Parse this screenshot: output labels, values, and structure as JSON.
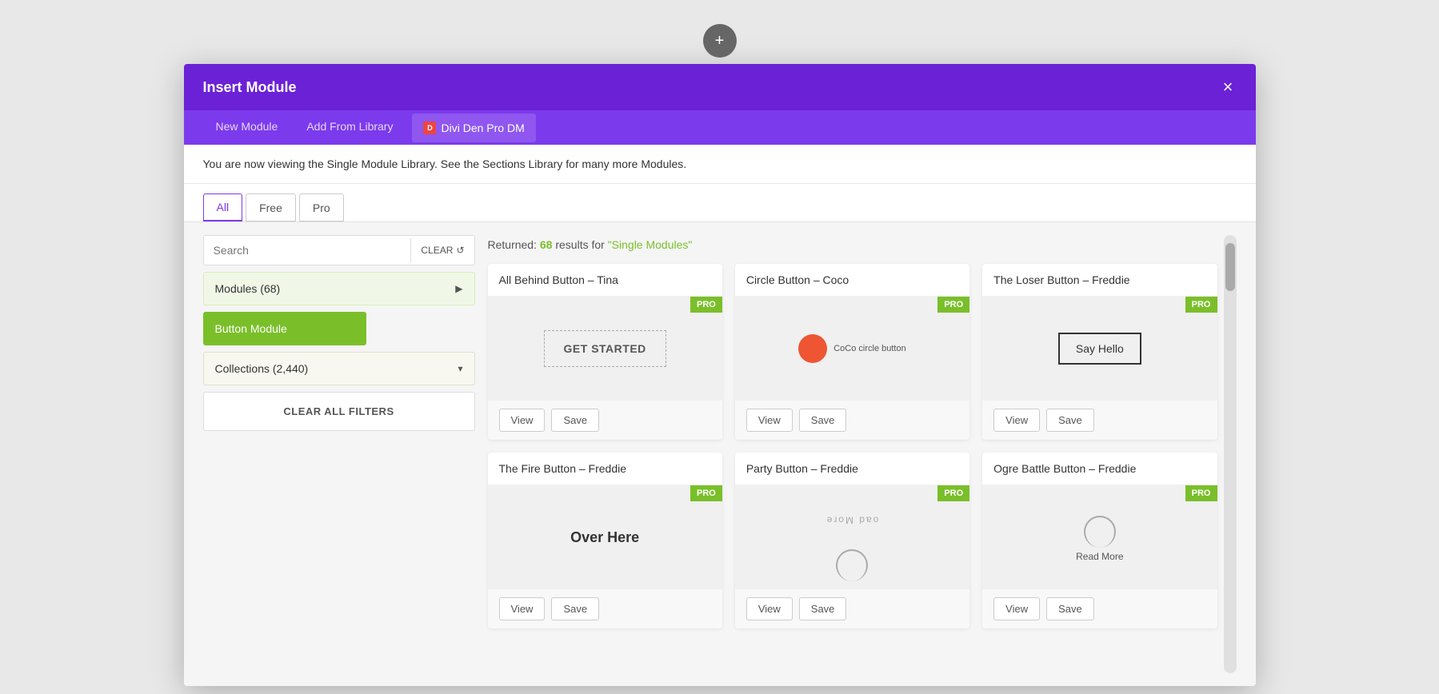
{
  "addButton": {
    "label": "+"
  },
  "modal": {
    "title": "Insert Module",
    "closeLabel": "×"
  },
  "tabs": [
    {
      "id": "new-module",
      "label": "New Module",
      "active": false
    },
    {
      "id": "add-from-library",
      "label": "Add From Library",
      "active": false
    },
    {
      "id": "divi-den-pro",
      "label": "Divi Den Pro DM",
      "active": true
    }
  ],
  "libraryNotice": "You are now viewing the Single Module Library. See the Sections Library for many more Modules.",
  "filterTabs": [
    {
      "id": "all",
      "label": "All",
      "active": true
    },
    {
      "id": "free",
      "label": "Free",
      "active": false
    },
    {
      "id": "pro",
      "label": "Pro",
      "active": false
    }
  ],
  "sidebar": {
    "searchPlaceholder": "Search",
    "clearLabel": "CLEAR",
    "modulesLabel": "Modules (68)",
    "highlightedFilter": "Button Module",
    "collectionsLabel": "Collections (2,440)",
    "clearAllFiltersLabel": "CLEAR ALL FILTERS"
  },
  "results": {
    "prefix": "Returned: ",
    "count": "68",
    "forText": " results for ",
    "query": "\"Single Modules\""
  },
  "modules": [
    {
      "id": "1",
      "title": "All Behind Button – Tina",
      "pro": true,
      "previewType": "get-started",
      "previewText": "GET STARTED",
      "viewLabel": "View",
      "saveLabel": "Save"
    },
    {
      "id": "2",
      "title": "Circle Button – Coco",
      "pro": true,
      "previewType": "circle-button",
      "previewText": "CoCo circle button",
      "viewLabel": "View",
      "saveLabel": "Save"
    },
    {
      "id": "3",
      "title": "The Loser Button – Freddie",
      "pro": true,
      "previewType": "say-hello",
      "previewText": "Say Hello",
      "viewLabel": "View",
      "saveLabel": "Save"
    },
    {
      "id": "4",
      "title": "The Fire Button – Freddie",
      "pro": true,
      "previewType": "over-here",
      "previewText": "Over Here",
      "viewLabel": "View",
      "saveLabel": "Save"
    },
    {
      "id": "5",
      "title": "Party Button – Freddie",
      "pro": true,
      "previewType": "read-more-arc",
      "previewText": "oad More",
      "viewLabel": "View",
      "saveLabel": "Save"
    },
    {
      "id": "6",
      "title": "Ogre Battle Button – Freddie",
      "pro": true,
      "previewType": "read-more-2",
      "previewText": "Read More",
      "viewLabel": "View",
      "saveLabel": "Save"
    }
  ],
  "proBadge": "PRO",
  "icons": {
    "refresh": "↺",
    "chevronRight": "▶",
    "chevronDown": "▾",
    "diviIcon": "D"
  }
}
